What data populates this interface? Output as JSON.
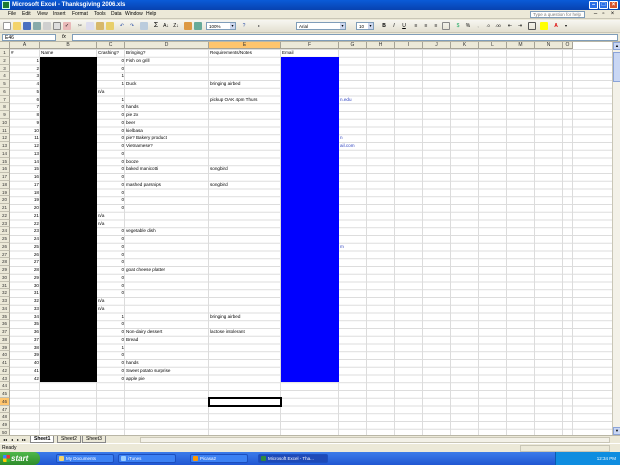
{
  "window": {
    "title": "Microsoft Excel - Thanksgiving 2006.xls"
  },
  "menu": {
    "items": [
      "File",
      "Edit",
      "View",
      "Insert",
      "Format",
      "Tools",
      "Data",
      "Window",
      "Help"
    ],
    "help_placeholder": "Type a question for help"
  },
  "toolbar": {
    "zoom": "100%",
    "font": "Arial",
    "font_size": "10"
  },
  "formula": {
    "namebox": "E46",
    "fx": "fx",
    "value": ""
  },
  "grid": {
    "columns": [
      "A",
      "B",
      "C",
      "D",
      "E",
      "F",
      "G",
      "H",
      "I",
      "J",
      "K",
      "L",
      "M",
      "N",
      "O"
    ],
    "row_numbers": [
      1,
      2,
      3,
      4,
      5,
      6,
      7,
      8,
      9,
      10,
      11,
      12,
      13,
      14,
      15,
      16,
      17,
      18,
      19,
      20,
      21,
      22,
      23,
      24,
      25,
      26,
      27,
      28,
      29,
      30,
      31,
      32,
      33,
      34,
      35,
      36,
      37,
      38,
      39,
      40,
      41,
      42,
      43,
      44,
      45,
      46,
      47,
      48,
      49,
      50,
      51
    ],
    "active_cell": "E46",
    "header_row": {
      "A": "#",
      "B": "Name",
      "C": "Crashing?",
      "D": "Bringing?",
      "E": "Requirements/Notes",
      "F": "Email"
    },
    "rows": [
      {
        "r": 2,
        "A": "1",
        "C": "0",
        "D": "Fish on grill"
      },
      {
        "r": 3,
        "A": "2",
        "C": "0"
      },
      {
        "r": 4,
        "A": "3",
        "C": "1"
      },
      {
        "r": 5,
        "A": "4",
        "C": "1",
        "D": "Duck",
        "E": "bringing airbed"
      },
      {
        "r": 6,
        "A": "5",
        "C": "n/a"
      },
      {
        "r": 7,
        "A": "6",
        "C": "1",
        "E": "pickup OAK 4pm Thurs",
        "G": "n.edu"
      },
      {
        "r": 8,
        "A": "7",
        "C": "0",
        "D": "hands"
      },
      {
        "r": 9,
        "A": "8",
        "C": "0",
        "D": "pie 2x"
      },
      {
        "r": 10,
        "A": "9",
        "C": "0",
        "D": "beer"
      },
      {
        "r": 11,
        "A": "10",
        "C": "0",
        "D": "kielbasa"
      },
      {
        "r": 12,
        "A": "11",
        "C": "0",
        "D": "pie? Bakery product",
        "G": "n"
      },
      {
        "r": 13,
        "A": "12",
        "C": "0",
        "D": "Vietnamese?",
        "G": "ail.com"
      },
      {
        "r": 14,
        "A": "13",
        "C": "0"
      },
      {
        "r": 15,
        "A": "14",
        "C": "0",
        "D": "booze"
      },
      {
        "r": 16,
        "A": "15",
        "C": "0",
        "D": "baked manicotti",
        "E": "songbird"
      },
      {
        "r": 17,
        "A": "16",
        "C": "0"
      },
      {
        "r": 18,
        "A": "17",
        "C": "0",
        "D": "mashed parsnips",
        "E": "songbird"
      },
      {
        "r": 19,
        "A": "18",
        "C": "0"
      },
      {
        "r": 20,
        "A": "19",
        "C": "0"
      },
      {
        "r": 21,
        "A": "20",
        "C": "0"
      },
      {
        "r": 22,
        "A": "21",
        "C": "n/a"
      },
      {
        "r": 23,
        "A": "22",
        "C": "n/a"
      },
      {
        "r": 24,
        "A": "23",
        "C": "0",
        "D": "vegetable dish"
      },
      {
        "r": 25,
        "A": "24",
        "C": "0"
      },
      {
        "r": 26,
        "A": "25",
        "C": "0",
        "G": "m"
      },
      {
        "r": 27,
        "A": "26",
        "C": "0"
      },
      {
        "r": 28,
        "A": "27",
        "C": "0"
      },
      {
        "r": 29,
        "A": "28",
        "C": "0",
        "D": "goat cheese platter"
      },
      {
        "r": 30,
        "A": "29",
        "C": "0"
      },
      {
        "r": 31,
        "A": "30",
        "C": "0"
      },
      {
        "r": 32,
        "A": "31",
        "C": "0"
      },
      {
        "r": 33,
        "A": "32",
        "C": "n/a"
      },
      {
        "r": 34,
        "A": "33",
        "C": "n/a"
      },
      {
        "r": 35,
        "A": "34",
        "C": "1",
        "E": "bringing airbed"
      },
      {
        "r": 36,
        "A": "35",
        "C": "0"
      },
      {
        "r": 37,
        "A": "36",
        "C": "0",
        "D": "Non-dairy dessert",
        "E": "lactose intolerant"
      },
      {
        "r": 38,
        "A": "37",
        "C": "0",
        "D": "Bread"
      },
      {
        "r": 39,
        "A": "38",
        "C": "1"
      },
      {
        "r": 40,
        "A": "39",
        "C": "0"
      },
      {
        "r": 41,
        "A": "40",
        "C": "0",
        "D": "hands"
      },
      {
        "r": 42,
        "A": "41",
        "C": "0",
        "D": "Sweet potato surprise"
      },
      {
        "r": 43,
        "A": "42",
        "C": "0",
        "D": "apple pie"
      }
    ],
    "redaction_colors": {
      "name_block": "#000000",
      "email_block": "#0000ff"
    }
  },
  "sheets": [
    "Sheet1",
    "Sheet2",
    "Sheet3"
  ],
  "active_sheet": "Sheet1",
  "status": {
    "text": "Ready"
  },
  "taskbar": {
    "start": "start",
    "tasks": [
      "My Documents",
      "iTunes",
      "Picasa2",
      "Microsoft Excel - Tha..."
    ],
    "active_task": 3,
    "clock": "12:34 PM"
  }
}
